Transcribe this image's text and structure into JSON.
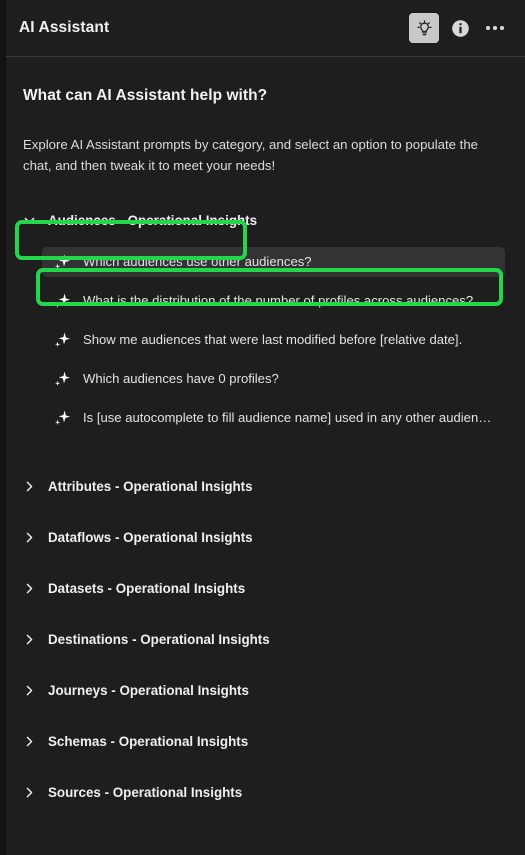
{
  "header": {
    "title": "AI Assistant",
    "actions": [
      {
        "name": "prompt-library-icon",
        "label": "Prompt library",
        "active": true
      },
      {
        "name": "info-icon",
        "label": "Information",
        "active": false
      },
      {
        "name": "more-options-icon",
        "label": "More options",
        "active": false
      }
    ]
  },
  "intro": {
    "heading": "What can AI Assistant help with?",
    "description": "Explore AI Assistant prompts by category, and select an option to populate the chat, and then tweak it to meet your needs!"
  },
  "colors": {
    "highlight": "#22d74b",
    "panel_background": "#1e1e1e",
    "hover_background": "#333333",
    "text_primary": "#f0f0f0"
  },
  "categories": [
    {
      "label": "Audiences - Operational Insights",
      "expanded": true,
      "chevron": "chevron-down-icon",
      "highlighted": true,
      "prompts": [
        {
          "text": "Which audiences use other audiences?",
          "hovered": true,
          "highlighted": true
        },
        {
          "text": "What is the distribution of the number of profiles across audiences?",
          "hovered": false,
          "highlighted": false
        },
        {
          "text": "Show me audiences that were last modified before [relative date].",
          "hovered": false,
          "highlighted": false
        },
        {
          "text": "Which audiences have 0 profiles?",
          "hovered": false,
          "highlighted": false
        },
        {
          "text": "Is [use autocomplete to fill audience name] used in any other audiences?",
          "hovered": false,
          "highlighted": false
        }
      ]
    },
    {
      "label": "Attributes - Operational Insights",
      "expanded": false,
      "chevron": "chevron-right-icon",
      "highlighted": false,
      "prompts": []
    },
    {
      "label": "Dataflows - Operational Insights",
      "expanded": false,
      "chevron": "chevron-right-icon",
      "highlighted": false,
      "prompts": []
    },
    {
      "label": "Datasets - Operational Insights",
      "expanded": false,
      "chevron": "chevron-right-icon",
      "highlighted": false,
      "prompts": []
    },
    {
      "label": "Destinations - Operational Insights",
      "expanded": false,
      "chevron": "chevron-right-icon",
      "highlighted": false,
      "prompts": []
    },
    {
      "label": "Journeys - Operational Insights",
      "expanded": false,
      "chevron": "chevron-right-icon",
      "highlighted": false,
      "prompts": []
    },
    {
      "label": "Schemas - Operational Insights",
      "expanded": false,
      "chevron": "chevron-right-icon",
      "highlighted": false,
      "prompts": []
    },
    {
      "label": "Sources - Operational Insights",
      "expanded": false,
      "chevron": "chevron-right-icon",
      "highlighted": false,
      "prompts": []
    }
  ]
}
